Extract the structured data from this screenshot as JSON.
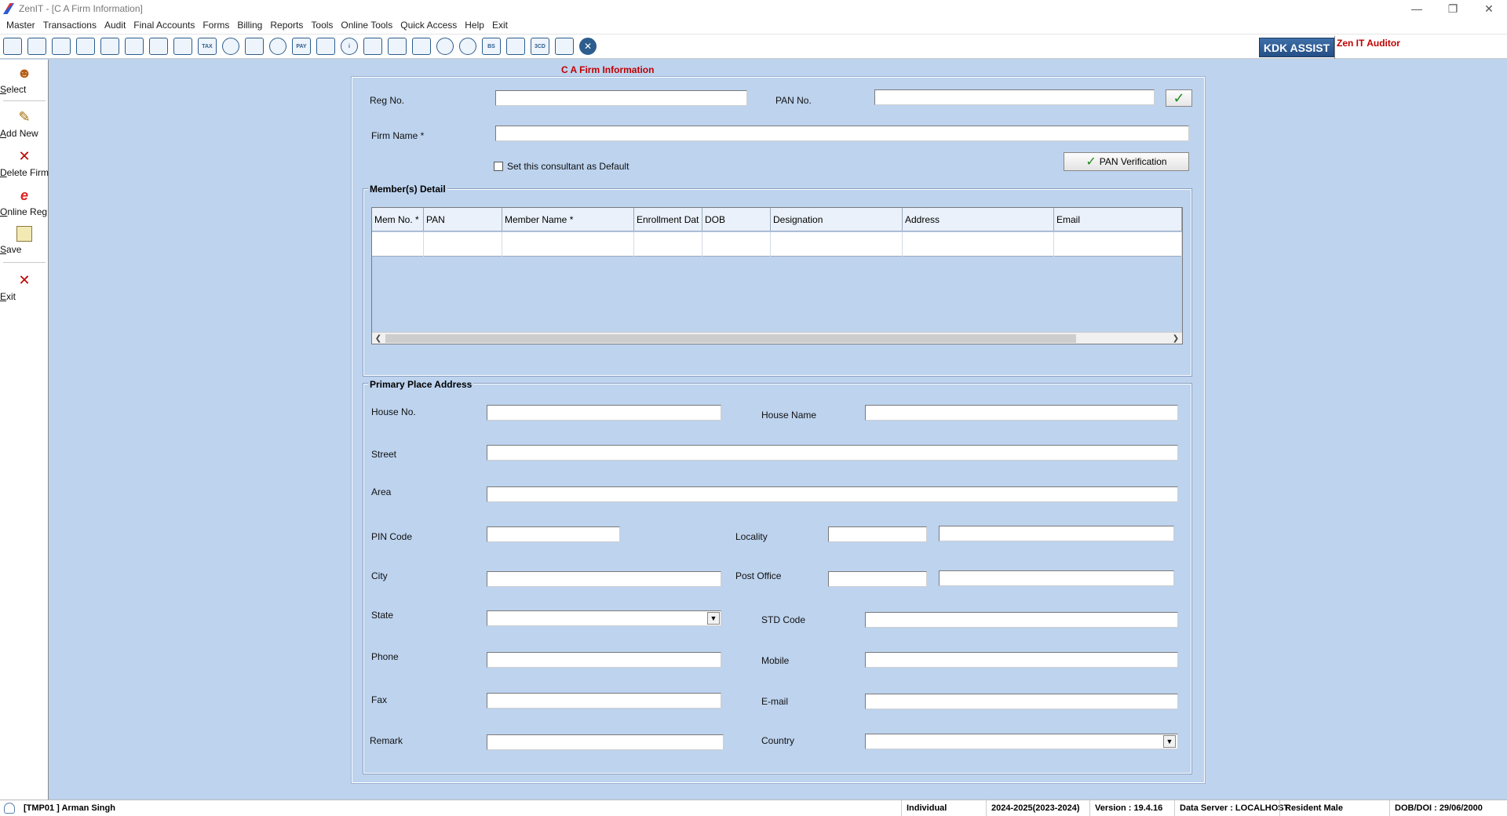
{
  "window": {
    "title": "ZenIT - [C A Firm Information]",
    "controls": {
      "minimize": "—",
      "restore": "❐",
      "close": "✕"
    }
  },
  "menu": [
    "Master",
    "Transactions",
    "Audit",
    "Final Accounts",
    "Forms",
    "Billing",
    "Reports",
    "Tools",
    "Online Tools",
    "Quick Access",
    "Help",
    "Exit"
  ],
  "toolbar": {
    "icons": [
      "form-icon",
      "home-icon",
      "building-icon",
      "chart-icon",
      "gift-icon",
      "group-icon",
      "hammer-icon",
      "funnel-icon",
      "tax-icon",
      "eye-icon",
      "calculator-icon",
      "pie-icon",
      "pay-icon",
      "book-icon",
      "info-icon",
      "report-icon",
      "notepad-icon",
      "calendar-icon",
      "refresh-icon",
      "sync-icon",
      "balance-sheet-icon",
      "factory-icon",
      "3cd-icon",
      "form-list-icon",
      "close-icon"
    ],
    "icon_text": [
      "",
      "",
      "",
      "",
      "",
      "",
      "",
      "",
      "TAX",
      "",
      "",
      "",
      "PAY",
      "",
      "i",
      "",
      "",
      "",
      "",
      "",
      "BS",
      "",
      "3CD",
      "",
      ""
    ],
    "kdk_label": "KDK ASSIST",
    "zen_label": "Zen IT Auditor"
  },
  "side": {
    "select": "Select",
    "add_new": "Add New",
    "delete_firm": "Delete Firm",
    "online_reg": "Online Reg",
    "save": "Save",
    "exit": "Exit"
  },
  "form": {
    "title": "C A Firm Information",
    "reg_no_label": "Reg No.",
    "reg_no_value": "",
    "pan_no_label": "PAN No.",
    "pan_no_value": "",
    "firm_name_label": "Firm Name *",
    "firm_name_value": "",
    "default_checkbox_label": "Set this consultant as Default",
    "pan_verification_label": "PAN Verification",
    "members_title": "Member(s) Detail",
    "member_columns": [
      "Mem No. *",
      "PAN",
      "Member Name *",
      "Enrollment Dat",
      "DOB",
      "Designation",
      "Address",
      "Email"
    ],
    "address_title": "Primary Place Address",
    "house_no": "House No.",
    "house_name": "House Name",
    "street": "Street",
    "area": "Area",
    "pin_code": "PIN Code",
    "locality": "Locality",
    "city": "City",
    "post_office": "Post Office",
    "state": "State",
    "std_code": "STD Code",
    "phone": "Phone",
    "mobile": "Mobile",
    "fax": "Fax",
    "email": "E-mail",
    "remark": "Remark",
    "country": "Country"
  },
  "status": {
    "user": "[TMP01 ] Arman Singh",
    "type": "Individual",
    "year": "2024-2025(2023-2024)",
    "version": "Version : 19.4.16",
    "server": "Data Server : LOCALHOST",
    "resident": "Resident Male",
    "dob": "DOB/DOI : 29/06/2000"
  }
}
